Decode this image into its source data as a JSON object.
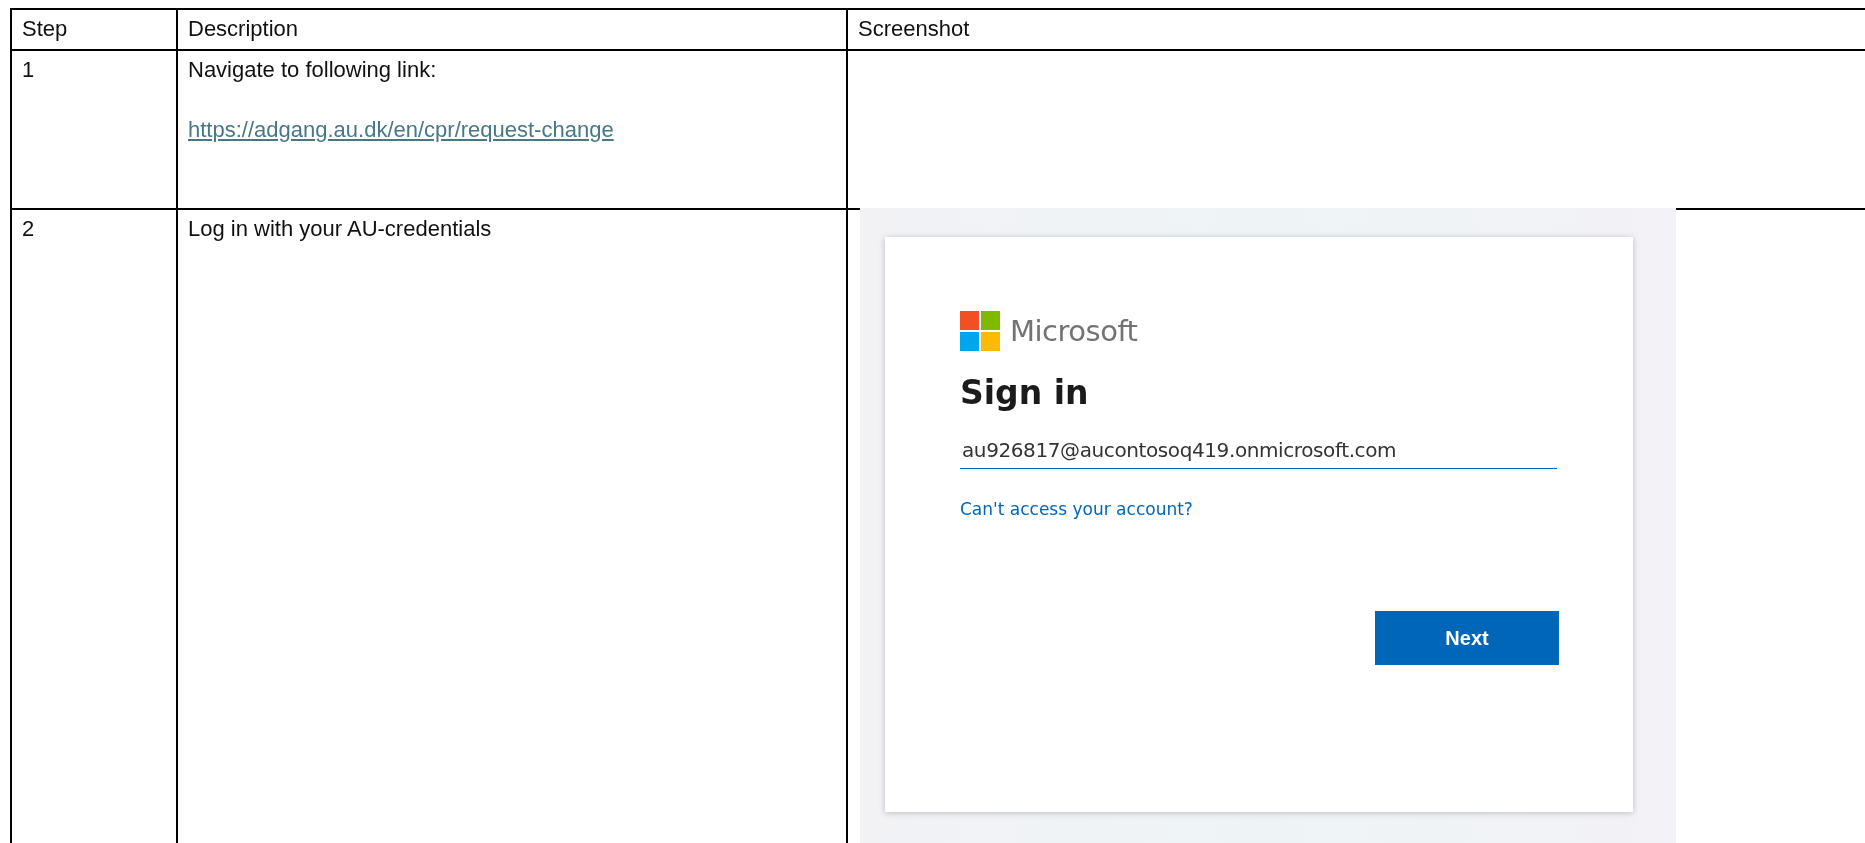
{
  "table": {
    "columns": [
      "Step",
      "Description",
      "Screenshot"
    ],
    "rows": [
      {
        "step": "1",
        "description": "Navigate to following link:",
        "link": "https://adgang.au.dk/en/cpr/request-change"
      },
      {
        "step": "2",
        "description": "Log in with your AU-credentials",
        "screenshot": {
          "brand": "Microsoft",
          "title": "Sign in",
          "email_value": "au926817@aucontosoq419.onmicrosoft.com",
          "help_link": "Can't access your account?",
          "button": "Next"
        }
      }
    ]
  }
}
